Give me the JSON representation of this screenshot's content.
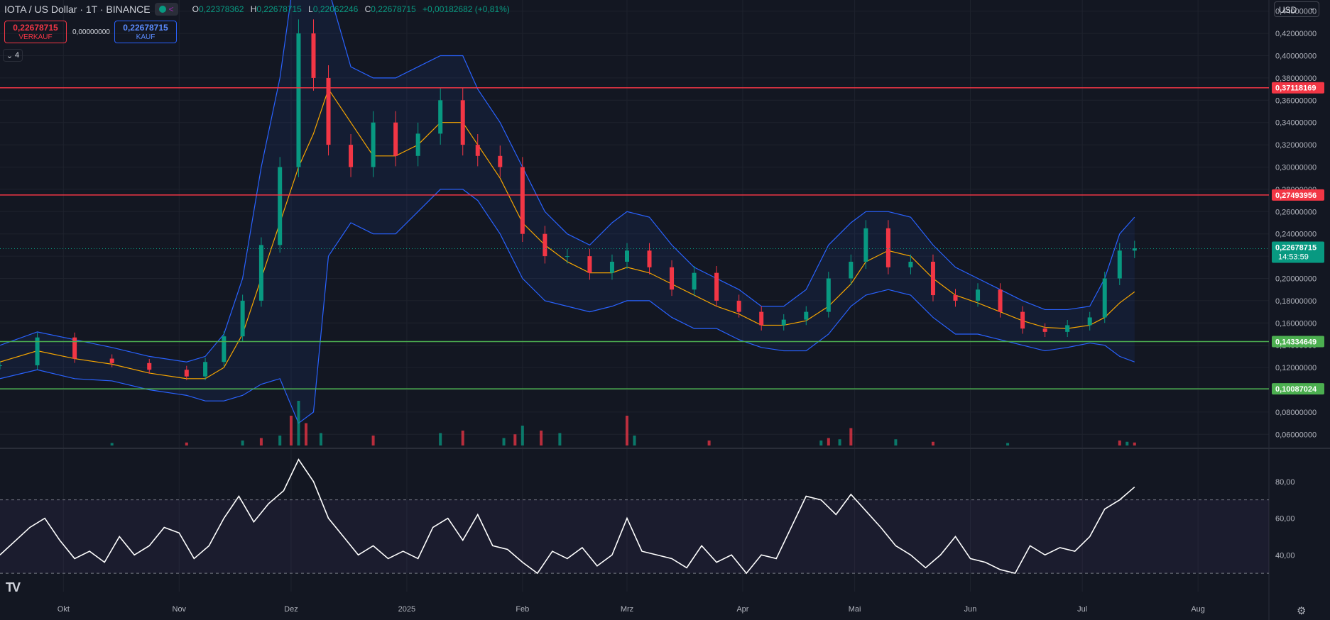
{
  "header": {
    "symbol": "IOTA / US Dollar · 1T · BINANCE",
    "ohlc": [
      {
        "k": "O",
        "v": "0,22378362"
      },
      {
        "k": "H",
        "v": "0,22678715"
      },
      {
        "k": "L",
        "v": "0,22062246"
      },
      {
        "k": "C",
        "v": "0,22678715"
      }
    ],
    "change": "+0,00182682 (+0,81%)",
    "indicator_count": "4"
  },
  "trade": {
    "sell_price": "0,22678715",
    "sell_label": "VERKAUF",
    "spread": "0,00000000",
    "buy_price": "0,22678715",
    "buy_label": "KAUF"
  },
  "currency": "USD",
  "colors": {
    "bg": "#131722",
    "up": "#089981",
    "down": "#f23645",
    "bb": "#2962ff",
    "ma": "#f7a600",
    "rsi": "#ffffff",
    "resistance": "#f23645",
    "support": "#4caf50"
  },
  "chart_data": {
    "type": "line",
    "title": "IOTA / US Dollar · 1T · BINANCE",
    "price_axis": {
      "ylim": [
        0.05,
        0.45
      ],
      "ticks": [
        0.06,
        0.08,
        0.1,
        0.12,
        0.14,
        0.16,
        0.18,
        0.2,
        0.22,
        0.24,
        0.26,
        0.28,
        0.3,
        0.32,
        0.34,
        0.36,
        0.38,
        0.4,
        0.42,
        0.44
      ],
      "tick_labels": [
        "0,06000000",
        "0,08000000",
        "0,10000000",
        "0,12000000",
        "0,14000000",
        "0,16000000",
        "0,18000000",
        "0,20000000",
        "0,22000000",
        "0,24000000",
        "0,26000000",
        "0,28000000",
        "0,30000000",
        "0,32000000",
        "0,34000000",
        "0,36000000",
        "0,38000000",
        "0,40000000",
        "0,42000000",
        "0,44000000"
      ]
    },
    "time_axis": {
      "x_range": [
        0,
        340
      ],
      "ticks": [
        {
          "x": 17,
          "label": "Okt"
        },
        {
          "x": 48,
          "label": "Nov"
        },
        {
          "x": 78,
          "label": "Dez"
        },
        {
          "x": 109,
          "label": "2025"
        },
        {
          "x": 140,
          "label": "Feb"
        },
        {
          "x": 168,
          "label": "Mrz"
        },
        {
          "x": 199,
          "label": "Apr"
        },
        {
          "x": 229,
          "label": "Mai"
        },
        {
          "x": 260,
          "label": "Jun"
        },
        {
          "x": 290,
          "label": "Jul"
        },
        {
          "x": 321,
          "label": "Aug"
        }
      ]
    },
    "horizontal_lines": [
      {
        "value": 0.37118169,
        "label": "0,37118169",
        "color": "#f23645"
      },
      {
        "value": 0.27493956,
        "label": "0,27493956",
        "color": "#f23645"
      },
      {
        "value": 0.14334649,
        "label": "0,14334649",
        "color": "#4caf50"
      },
      {
        "value": 0.10087024,
        "label": "0,10087024",
        "color": "#4caf50"
      }
    ],
    "last_price": {
      "value": 0.22678715,
      "label": "0,22678715",
      "countdown": "14:53:59"
    },
    "price_series": {
      "name": "IOTA / US Dollar",
      "x": [
        0,
        10,
        20,
        30,
        40,
        50,
        55,
        60,
        65,
        70,
        75,
        80,
        84,
        88,
        94,
        100,
        106,
        112,
        118,
        124,
        128,
        134,
        140,
        146,
        152,
        158,
        164,
        168,
        174,
        180,
        186,
        192,
        198,
        204,
        210,
        216,
        222,
        228,
        232,
        238,
        244,
        250,
        256,
        262,
        268,
        274,
        280,
        286,
        292,
        296,
        300,
        304
      ],
      "close": [
        0.122,
        0.147,
        0.128,
        0.124,
        0.118,
        0.112,
        0.125,
        0.148,
        0.18,
        0.23,
        0.3,
        0.42,
        0.38,
        0.32,
        0.3,
        0.34,
        0.31,
        0.33,
        0.36,
        0.32,
        0.31,
        0.3,
        0.24,
        0.22,
        0.22,
        0.205,
        0.215,
        0.225,
        0.21,
        0.19,
        0.205,
        0.18,
        0.17,
        0.158,
        0.163,
        0.17,
        0.2,
        0.215,
        0.245,
        0.21,
        0.215,
        0.185,
        0.18,
        0.19,
        0.17,
        0.155,
        0.152,
        0.158,
        0.165,
        0.2,
        0.225,
        0.227
      ]
    },
    "bollinger": {
      "upper": [
        0.14,
        0.152,
        0.145,
        0.138,
        0.13,
        0.125,
        0.13,
        0.15,
        0.2,
        0.3,
        0.38,
        0.5,
        0.52,
        0.46,
        0.39,
        0.38,
        0.38,
        0.39,
        0.4,
        0.4,
        0.37,
        0.34,
        0.3,
        0.26,
        0.24,
        0.23,
        0.25,
        0.26,
        0.255,
        0.23,
        0.21,
        0.2,
        0.19,
        0.175,
        0.175,
        0.19,
        0.23,
        0.25,
        0.26,
        0.26,
        0.255,
        0.23,
        0.21,
        0.2,
        0.19,
        0.18,
        0.172,
        0.172,
        0.175,
        0.2,
        0.24,
        0.255
      ],
      "lower": [
        0.11,
        0.118,
        0.11,
        0.108,
        0.1,
        0.095,
        0.09,
        0.09,
        0.095,
        0.105,
        0.11,
        0.07,
        0.08,
        0.22,
        0.25,
        0.24,
        0.24,
        0.26,
        0.28,
        0.28,
        0.27,
        0.24,
        0.2,
        0.18,
        0.175,
        0.17,
        0.175,
        0.18,
        0.18,
        0.165,
        0.155,
        0.155,
        0.145,
        0.138,
        0.135,
        0.135,
        0.15,
        0.175,
        0.185,
        0.19,
        0.185,
        0.165,
        0.15,
        0.15,
        0.145,
        0.14,
        0.135,
        0.138,
        0.142,
        0.14,
        0.13,
        0.125
      ]
    },
    "moving_average": [
      0.125,
      0.135,
      0.128,
      0.123,
      0.115,
      0.11,
      0.11,
      0.12,
      0.15,
      0.2,
      0.25,
      0.3,
      0.33,
      0.37,
      0.34,
      0.31,
      0.31,
      0.32,
      0.34,
      0.34,
      0.32,
      0.29,
      0.25,
      0.23,
      0.215,
      0.205,
      0.205,
      0.21,
      0.205,
      0.195,
      0.185,
      0.175,
      0.168,
      0.158,
      0.158,
      0.162,
      0.175,
      0.195,
      0.215,
      0.225,
      0.22,
      0.2,
      0.185,
      0.178,
      0.17,
      0.162,
      0.156,
      0.155,
      0.158,
      0.165,
      0.178,
      0.188
    ],
    "volume": {
      "x": [
        30,
        50,
        65,
        70,
        75,
        78,
        80,
        82,
        86,
        100,
        118,
        124,
        135,
        138,
        140,
        145,
        150,
        168,
        170,
        190,
        220,
        222,
        225,
        228,
        240,
        250,
        270,
        300,
        302,
        304
      ],
      "values": [
        10,
        12,
        20,
        30,
        40,
        120,
        180,
        90,
        50,
        40,
        50,
        60,
        30,
        45,
        80,
        60,
        50,
        120,
        40,
        20,
        20,
        30,
        25,
        70,
        25,
        15,
        10,
        20,
        15,
        12
      ]
    },
    "rsi": {
      "ylim": [
        20,
        95
      ],
      "ticks": [
        40,
        60,
        80
      ],
      "tick_labels": [
        "40,00",
        "60,00",
        "80,00"
      ],
      "overbought": 70,
      "oversold": 30,
      "x": [
        0,
        8,
        12,
        16,
        20,
        24,
        28,
        32,
        36,
        40,
        44,
        48,
        52,
        56,
        60,
        64,
        68,
        72,
        76,
        80,
        84,
        88,
        92,
        96,
        100,
        104,
        108,
        112,
        116,
        120,
        124,
        128,
        132,
        136,
        140,
        144,
        148,
        152,
        156,
        160,
        164,
        168,
        172,
        176,
        180,
        184,
        188,
        192,
        196,
        200,
        204,
        208,
        212,
        216,
        220,
        224,
        228,
        232,
        236,
        240,
        244,
        248,
        252,
        256,
        260,
        264,
        268,
        272,
        276,
        280,
        284,
        288,
        292,
        296,
        300,
        304
      ],
      "values": [
        40,
        55,
        60,
        48,
        38,
        42,
        36,
        50,
        40,
        45,
        55,
        52,
        38,
        45,
        60,
        72,
        58,
        68,
        75,
        92,
        80,
        60,
        50,
        40,
        45,
        38,
        42,
        38,
        55,
        60,
        48,
        62,
        45,
        43,
        36,
        30,
        42,
        38,
        44,
        34,
        40,
        60,
        42,
        40,
        38,
        33,
        45,
        36,
        40,
        30,
        40,
        38,
        55,
        72,
        70,
        62,
        73,
        64,
        55,
        45,
        40,
        33,
        40,
        50,
        38,
        36,
        32,
        30,
        45,
        40,
        44,
        42,
        50,
        65,
        70,
        77
      ]
    }
  }
}
